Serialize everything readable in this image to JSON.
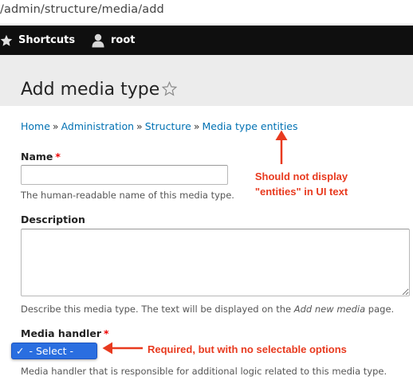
{
  "browser": {
    "url": "/admin/structure/media/add"
  },
  "toolbar": {
    "shortcuts_label": "Shortcuts",
    "user_label": "root"
  },
  "header": {
    "title": "Add media type"
  },
  "breadcrumb": {
    "items": [
      "Home",
      "Administration",
      "Structure",
      "Media type entities"
    ],
    "separator": "»"
  },
  "form": {
    "name": {
      "label": "Name",
      "required_marker": "*",
      "value": "",
      "help": "The human-readable name of this media type."
    },
    "description": {
      "label": "Description",
      "value": "",
      "help_before": "Describe this media type. The text will be displayed on the ",
      "help_emphasis": "Add new media",
      "help_after": " page."
    },
    "media_handler": {
      "label": "Media handler",
      "required_marker": "*",
      "check_mark": "✓",
      "selected": "- Select -",
      "help": "Media handler that is responsible for additional logic related to this media type."
    }
  },
  "annotations": {
    "breadcrumb_note_line1": "Should not display",
    "breadcrumb_note_line2": "\"entities\" in UI text",
    "handler_note": "Required, but with no selectable options",
    "color": "#e83a1f"
  },
  "colors": {
    "link": "#0071b3",
    "toolbar_bg": "#0f0f0f",
    "header_bg": "#ececec",
    "required": "#ee0000",
    "select_bg": "#2a6ee0"
  },
  "icons": {
    "shortcuts": "star-filled-icon",
    "user": "user-icon",
    "favorite": "star-outline-icon"
  }
}
